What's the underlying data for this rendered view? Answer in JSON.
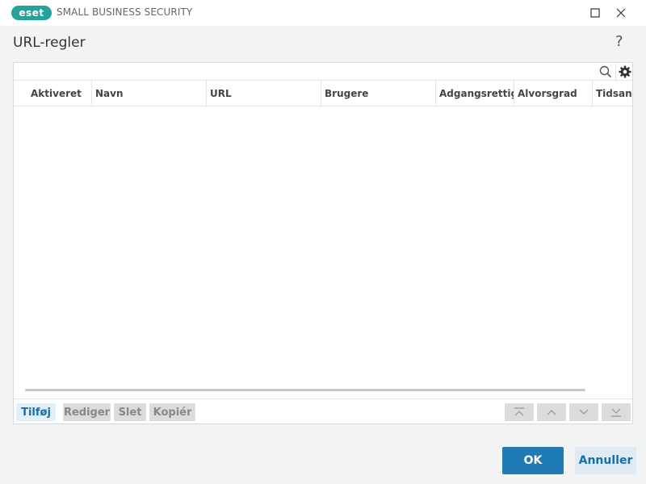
{
  "titlebar": {
    "logo_text": "eset",
    "product": "SMALL BUSINESS SECURITY",
    "maximize_icon": "maximize-icon",
    "close_icon": "close-icon"
  },
  "page": {
    "title": "URL-regler",
    "help_label": "?"
  },
  "table": {
    "columns": [
      "Aktiveret",
      "Navn",
      "URL",
      "Brugere",
      "Adgangsrettig...",
      "Alvorsgrad",
      "Tidsangi"
    ],
    "rows": []
  },
  "list_actions": {
    "add": "Tilføj",
    "edit": "Rediger",
    "delete": "Slet",
    "copy": "Kopiér"
  },
  "dialog": {
    "ok": "OK",
    "cancel": "Annuller"
  },
  "colors": {
    "brand": "#25a29a",
    "accent": "#1e7bb4",
    "accent_light": "#deebf5"
  }
}
